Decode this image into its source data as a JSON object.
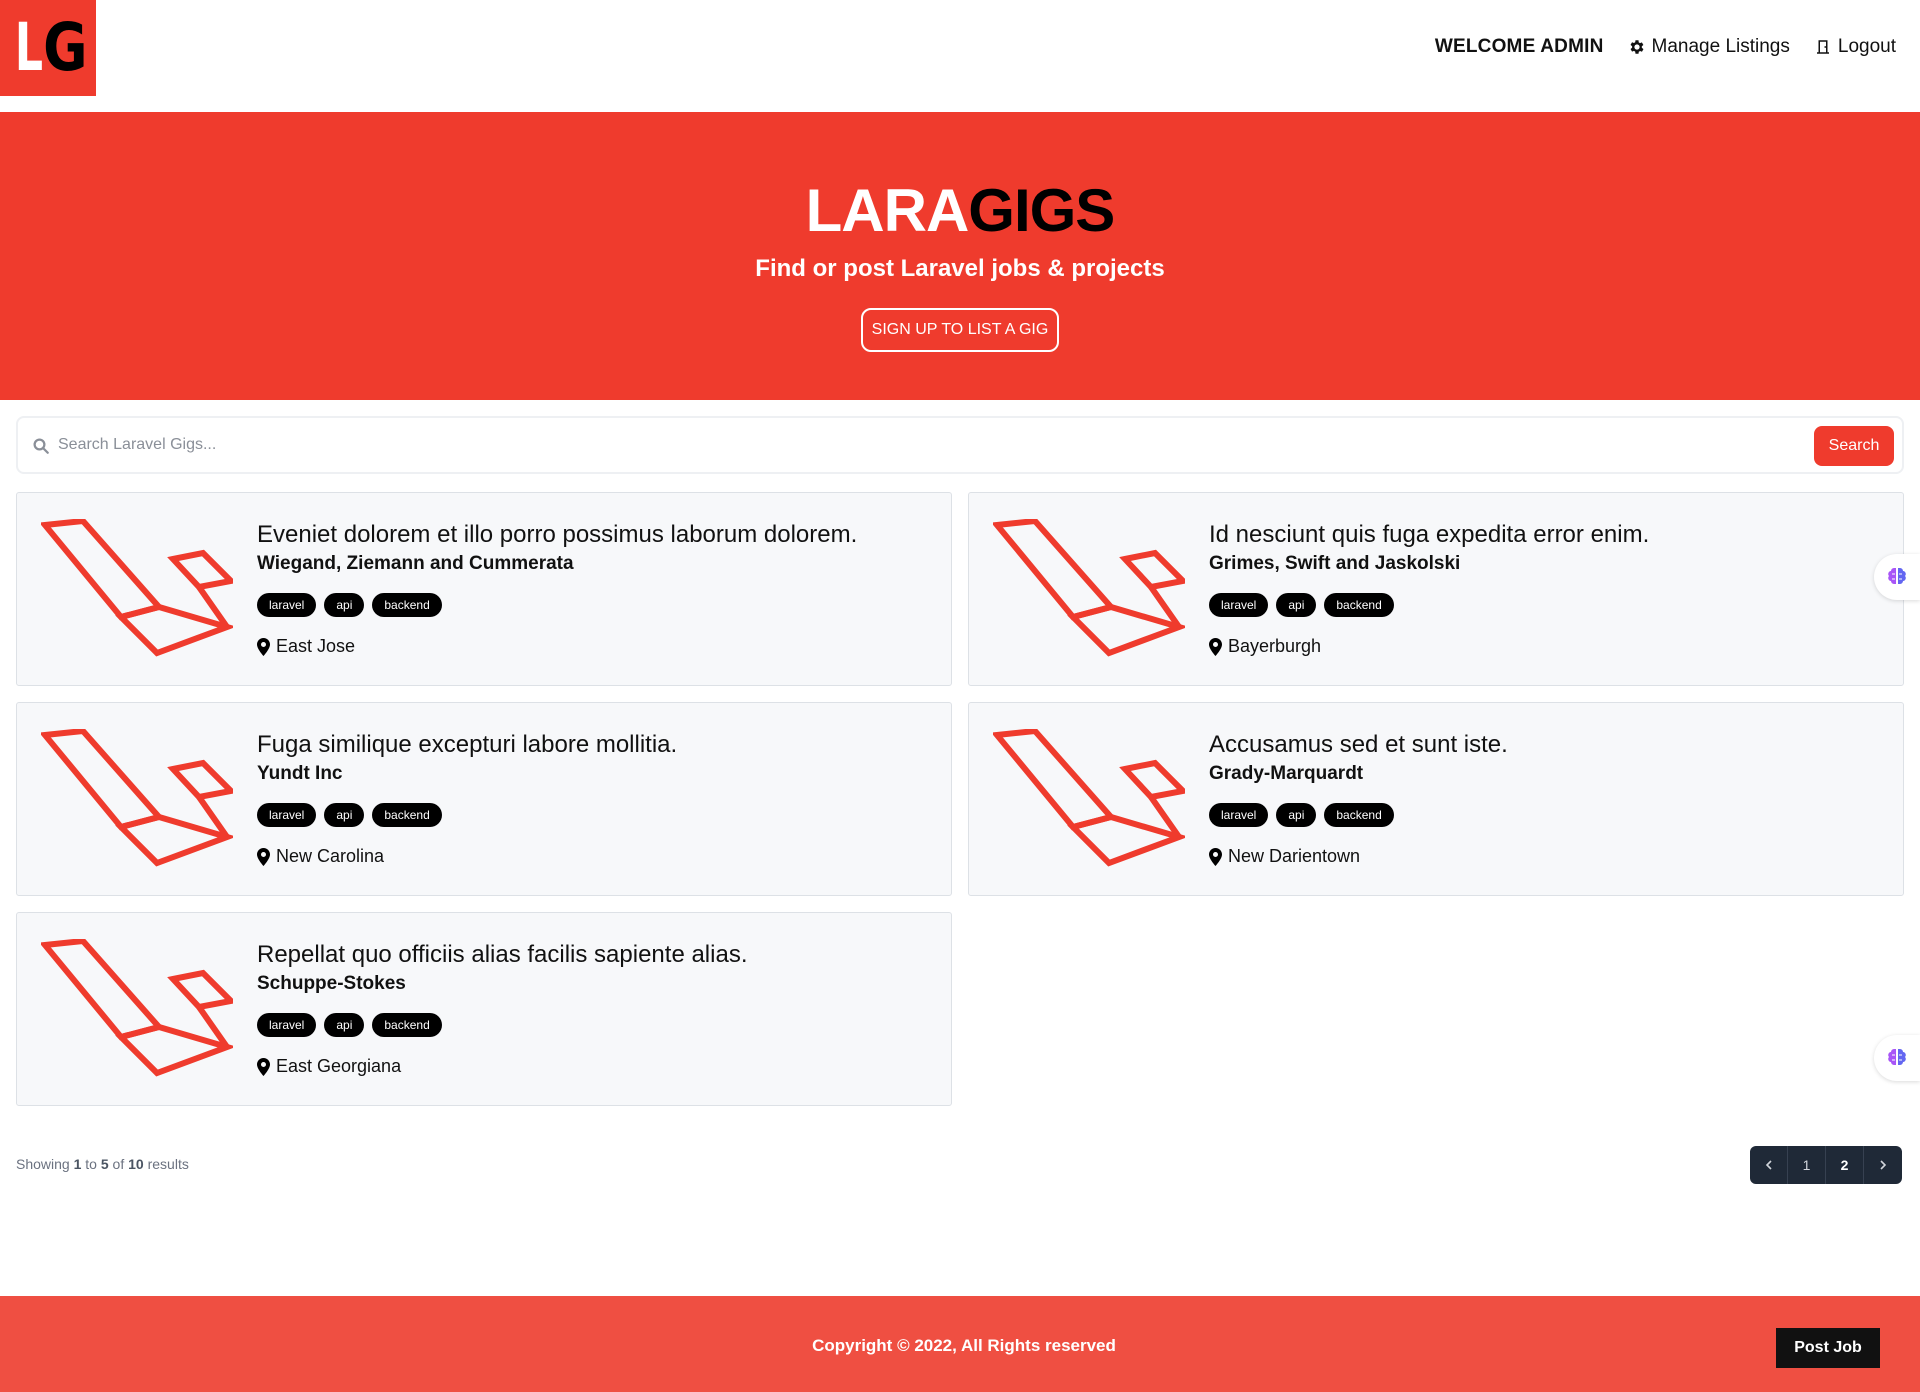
{
  "brand": {
    "logo_left": "L",
    "logo_right": "G",
    "accent": "#ef3b2d"
  },
  "nav": {
    "welcome": "Welcome Admin",
    "manage": "Manage Listings",
    "logout": "Logout",
    "manage_icon": "gear-icon",
    "logout_icon": "door-icon"
  },
  "hero": {
    "title_light": "LARA",
    "title_dark": "GIGS",
    "subtitle": "Find or post Laravel jobs & projects",
    "cta": "Sign Up to List a Gig"
  },
  "search": {
    "placeholder": "Search Laravel Gigs...",
    "button": "Search"
  },
  "listings": [
    {
      "title": "Eveniet dolorem et illo porro possimus laborum dolorem.",
      "company": "Wiegand, Ziemann and Cummerata",
      "tags": [
        "laravel",
        "api",
        "backend"
      ],
      "location": "East Jose"
    },
    {
      "title": "Id nesciunt quis fuga expedita error enim.",
      "company": "Grimes, Swift and Jaskolski",
      "tags": [
        "laravel",
        "api",
        "backend"
      ],
      "location": "Bayerburgh"
    },
    {
      "title": "Fuga similique excepturi labore mollitia.",
      "company": "Yundt Inc",
      "tags": [
        "laravel",
        "api",
        "backend"
      ],
      "location": "New Carolina"
    },
    {
      "title": "Accusamus sed et sunt iste.",
      "company": "Grady-Marquardt",
      "tags": [
        "laravel",
        "api",
        "backend"
      ],
      "location": "New Darientown"
    },
    {
      "title": "Repellat quo officiis alias facilis sapiente alias.",
      "company": "Schuppe-Stokes",
      "tags": [
        "laravel",
        "api",
        "backend"
      ],
      "location": "East Georgiana"
    }
  ],
  "pagination": {
    "showing_prefix": "Showing",
    "from": "1",
    "to_word": "to",
    "to": "5",
    "of_word": "of",
    "total": "10",
    "results_word": "results",
    "pages": [
      "1",
      "2"
    ],
    "current": "2"
  },
  "footer": {
    "copyright": "Copyright © 2022, All Rights reserved",
    "post_job": "Post Job"
  }
}
